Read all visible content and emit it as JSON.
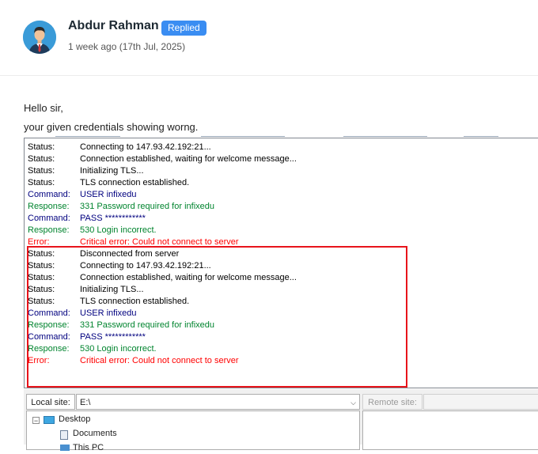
{
  "post": {
    "author": "Abdur Rahman",
    "status_badge": "Replied",
    "date": "1 week ago (17th Jul, 2025)"
  },
  "message": {
    "line1": "Hello sir,",
    "line2": "your given credentials showing worng."
  },
  "ftp_log": [
    {
      "type": "status",
      "label": "Status:",
      "text": "Connecting to 147.93.42.192:21..."
    },
    {
      "type": "status",
      "label": "Status:",
      "text": "Connection established, waiting for welcome message..."
    },
    {
      "type": "status",
      "label": "Status:",
      "text": "Initializing TLS..."
    },
    {
      "type": "status",
      "label": "Status:",
      "text": "TLS connection established."
    },
    {
      "type": "command",
      "label": "Command:",
      "text": "USER infixedu"
    },
    {
      "type": "response",
      "label": "Response:",
      "text": "331 Password required for infixedu"
    },
    {
      "type": "command",
      "label": "Command:",
      "text": "PASS ************"
    },
    {
      "type": "response",
      "label": "Response:",
      "text": "530 Login incorrect."
    },
    {
      "type": "error",
      "label": "Error:",
      "text": "Critical error: Could not connect to server"
    },
    {
      "type": "status",
      "label": "Status:",
      "text": "Disconnected from server"
    },
    {
      "type": "status",
      "label": "Status:",
      "text": "Connecting to 147.93.42.192:21..."
    },
    {
      "type": "status",
      "label": "Status:",
      "text": "Connection established, waiting for welcome message..."
    },
    {
      "type": "status",
      "label": "Status:",
      "text": "Initializing TLS..."
    },
    {
      "type": "status",
      "label": "Status:",
      "text": "TLS connection established."
    },
    {
      "type": "command",
      "label": "Command:",
      "text": "USER infixedu"
    },
    {
      "type": "response",
      "label": "Response:",
      "text": "331 Password required for infixedu"
    },
    {
      "type": "command",
      "label": "Command:",
      "text": "PASS ************"
    },
    {
      "type": "response",
      "label": "Response:",
      "text": "530 Login incorrect."
    },
    {
      "type": "error",
      "label": "Error:",
      "text": "Critical error: Could not connect to server"
    }
  ],
  "local_site": {
    "label": "Local site:",
    "path": "E:\\",
    "tree": [
      "Desktop",
      "Documents",
      "This PC"
    ]
  },
  "remote_site": {
    "label": "Remote site:"
  },
  "colors": {
    "status": "#000000",
    "command": "#00007f",
    "response": "#00842e",
    "error": "#ff0000",
    "badge": "#3a8df2",
    "highlight_box": "#e8141b"
  }
}
